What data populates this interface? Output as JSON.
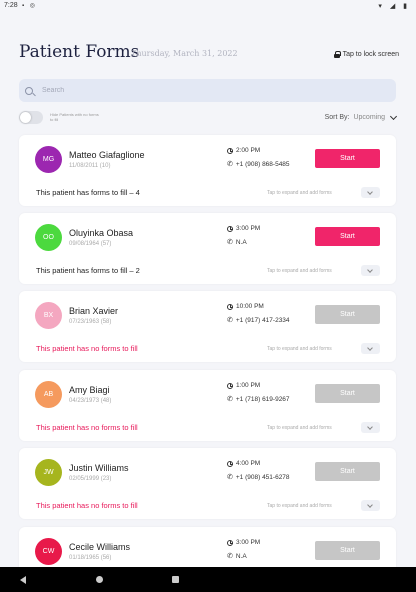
{
  "statusbar": {
    "time": "7:28",
    "left_icons": "▪ ◎",
    "right_icons": "▾ ◢ ▮"
  },
  "header": {
    "title": "Patient Forms",
    "date": "Thursday, March 31, 2022",
    "lock_label": "Tap to lock screen"
  },
  "search": {
    "placeholder": "Search"
  },
  "filters": {
    "toggle_label": "Hide Patients with no forms to fill",
    "sort_label": "Sort By:",
    "sort_value": "Upcoming"
  },
  "card_common": {
    "start_label": "Start",
    "expand_label": "Tap to expand and add forms"
  },
  "patients": [
    {
      "initials": "MG",
      "color": "#9c27b0",
      "name": "Matteo Giafaglione",
      "dob": "11/08/2011 (10)",
      "time": "2:00 PM",
      "phone": "+1 (908) 868-5485",
      "status": "This patient has forms to fill – 4",
      "has_forms": true
    },
    {
      "initials": "OO",
      "color": "#4cd93e",
      "name": "Oluyinka Obasa",
      "dob": "09/08/1964 (57)",
      "time": "3:00 PM",
      "phone": "N.A",
      "status": "This patient has forms to fill – 2",
      "has_forms": true
    },
    {
      "initials": "BX",
      "color": "#f4a7c0",
      "name": "Brian Xavier",
      "dob": "07/23/1963 (58)",
      "time": "10:00 PM",
      "phone": "+1 (917) 417-2334",
      "status": "This patient has no forms to fill",
      "has_forms": false
    },
    {
      "initials": "AB",
      "color": "#f59a5e",
      "name": "Amy Biagi",
      "dob": "04/23/1973 (48)",
      "time": "1:00 PM",
      "phone": "+1 (718) 619-9267",
      "status": "This patient has no forms to fill",
      "has_forms": false
    },
    {
      "initials": "JW",
      "color": "#a6b51e",
      "name": "Justin Williams",
      "dob": "02/05/1999 (23)",
      "time": "4:00 PM",
      "phone": "+1 (908) 451-6278",
      "status": "This patient has no forms to fill",
      "has_forms": false
    },
    {
      "initials": "CW",
      "color": "#e8194a",
      "name": "Cecile  Williams",
      "dob": "01/18/1965 (56)",
      "time": "3:00 PM",
      "phone": "N.A",
      "status": "",
      "has_forms": false
    }
  ]
}
